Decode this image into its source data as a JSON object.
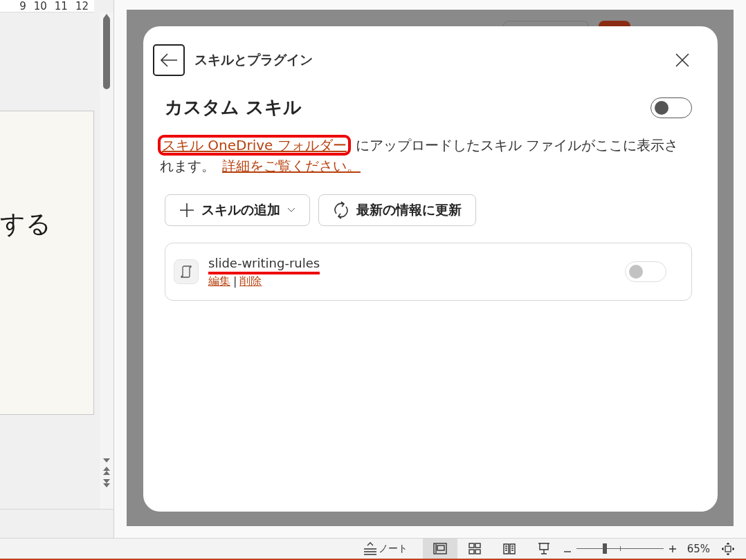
{
  "ruler": {
    "ticks": [
      "9",
      "10",
      "11",
      "12"
    ]
  },
  "slide": {
    "text": "する"
  },
  "dialog": {
    "title": "スキルとプラグイン",
    "section": {
      "title": "カスタム スキル",
      "on": false
    },
    "description": {
      "link": {
        "text": "スキル OneDrive フォルダー",
        "highlighted": true
      },
      "text": "にアップロードしたスキル ファイルがここに表示されます。",
      "more_link": "詳細をご覧ください。"
    },
    "buttons": [
      {
        "kind": "add",
        "label": "スキルの追加"
      },
      {
        "kind": "refresh",
        "label": "最新の情報に更新"
      }
    ],
    "skills": [
      {
        "name": "slide-writing-rules",
        "marked": true,
        "on": false,
        "disabled": true,
        "actions": [
          "編集",
          "削除"
        ],
        "separator": "|"
      }
    ]
  },
  "status_bar": {
    "notes": "ノート",
    "views": [
      {
        "kind": "normal",
        "selected": true
      },
      {
        "kind": "sorter",
        "selected": false
      },
      {
        "kind": "reading",
        "selected": false
      },
      {
        "kind": "show",
        "selected": false
      }
    ],
    "zoom": {
      "level": 0.33,
      "reading": "65%"
    }
  }
}
